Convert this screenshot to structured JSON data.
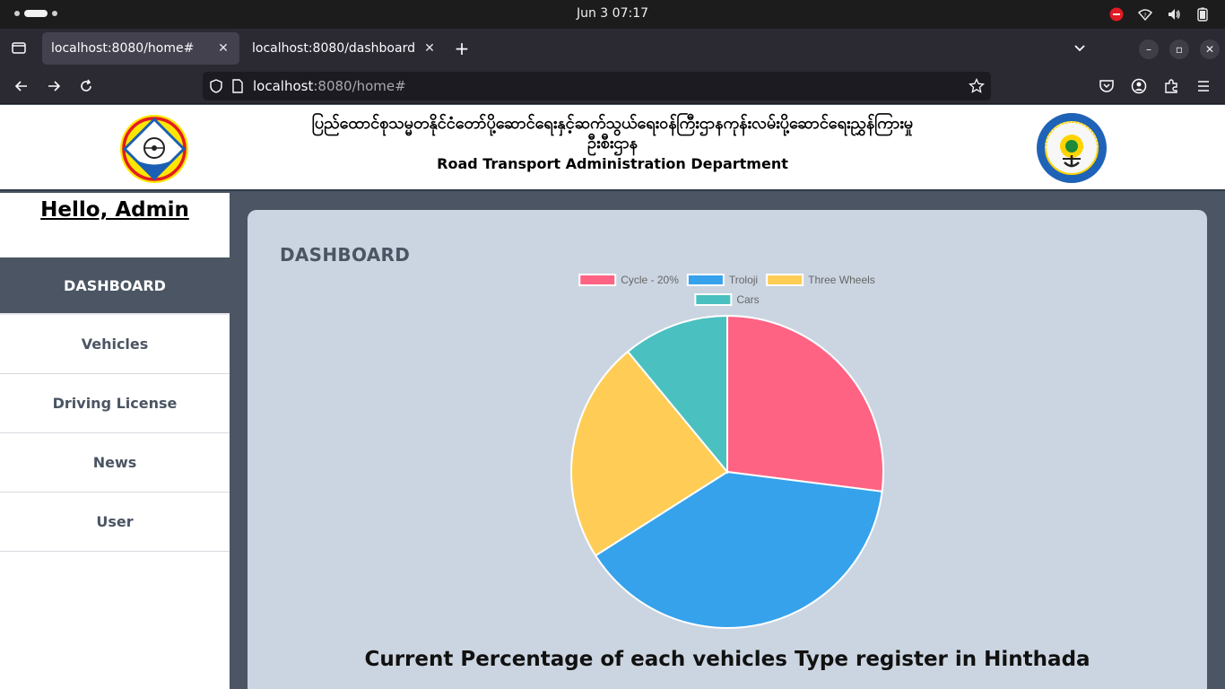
{
  "os": {
    "clock": "Jun 3  07:17"
  },
  "browser": {
    "tabs": [
      {
        "label": "localhost:8080/home#",
        "active": true
      },
      {
        "label": "localhost:8080/dashboard",
        "active": false
      }
    ],
    "url_host": "localhost",
    "url_rest": ":8080/home#"
  },
  "header": {
    "title_mm": "ပြည်ထောင်စုသမ္မတနိုင်ငံတော်ပို့ဆောင်ရေးနှင့်ဆက်သွယ်ရေးဝန်ကြီးဌာနကုန်းလမ်းပို့ဆောင်ရေးညွှန်ကြားမှုဦးစီးဌာန",
    "title_en": "Road Transport Administration Department"
  },
  "sidebar": {
    "greeting": "Hello, Admin",
    "items": [
      {
        "label": "DASHBOARD",
        "active": true
      },
      {
        "label": "Vehicles",
        "active": false
      },
      {
        "label": "Driving License",
        "active": false
      },
      {
        "label": "News",
        "active": false
      },
      {
        "label": "User",
        "active": false
      }
    ]
  },
  "main": {
    "heading": "DASHBOARD",
    "caption": "Current Percentage of each vehicles Type register in Hinthada"
  },
  "chart_data": {
    "type": "pie",
    "categories": [
      "Cycle - 20%",
      "Troloji",
      "Three Wheels",
      "Cars"
    ],
    "values": [
      27,
      39,
      23,
      11
    ],
    "colors": [
      "#ff6384",
      "#36a2eb",
      "#ffcd56",
      "#4bc0c0"
    ],
    "legend": "top",
    "title": "Current Percentage of each vehicles Type register in Hinthada"
  }
}
